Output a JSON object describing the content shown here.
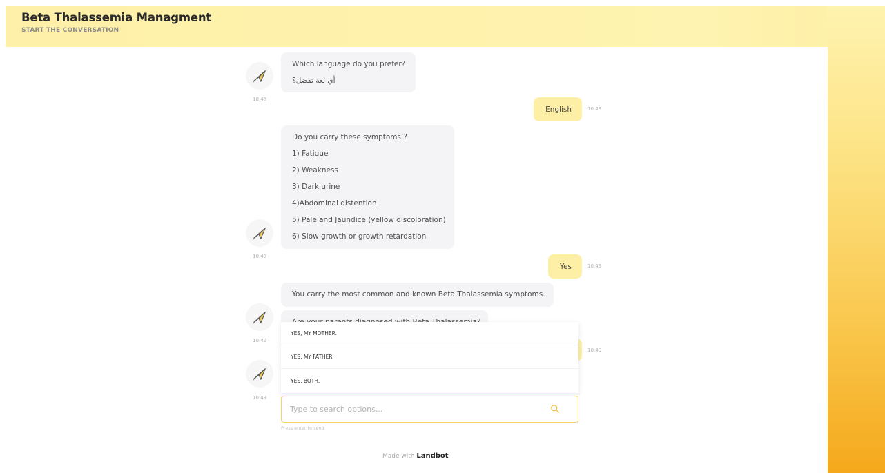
{
  "header": {
    "title": "Beta Thalassemia Managment",
    "subtitle": "START THE CONVERSATION"
  },
  "messages": {
    "m1": {
      "line1": "Which language do you prefer?",
      "line2": "أي لغة تفضل؟",
      "time": "10:48"
    },
    "m2": {
      "text": "English",
      "time": "10:49"
    },
    "m3": {
      "lines": [
        "Do you carry these symptoms ?",
        "1) Fatigue",
        "2) Weakness",
        "3) Dark urine",
        "4)Abdominal distention",
        "5) Pale and Jaundice (yellow discoloration)",
        "6) Slow growth or growth retardation"
      ],
      "time": "10:49"
    },
    "m4": {
      "text": "Yes",
      "time": "10:49"
    },
    "m5": {
      "text": "You carry the most common and known Beta Thalassemia symptoms."
    },
    "m6": {
      "text": "Are your parents diagnosed with Beta Thalassemia?",
      "time": "10:49"
    },
    "m7": {
      "time": "10:49"
    },
    "m8": {
      "time": "10:49"
    }
  },
  "options": [
    "YES, MY MOTHER.",
    "YES, MY FATHER.",
    "YES, BOTH."
  ],
  "search": {
    "placeholder": "Type to search options...",
    "hint": "Press enter to send"
  },
  "footer": {
    "prefix": "Made with",
    "brand": "Landbot"
  },
  "colors": {
    "accent": "#f4d36a",
    "user_bubble": "#fdf0a6",
    "gradient_end": "#f5a81b"
  },
  "icons": {
    "avatar": "paper-plane-icon",
    "search": "search-icon"
  }
}
